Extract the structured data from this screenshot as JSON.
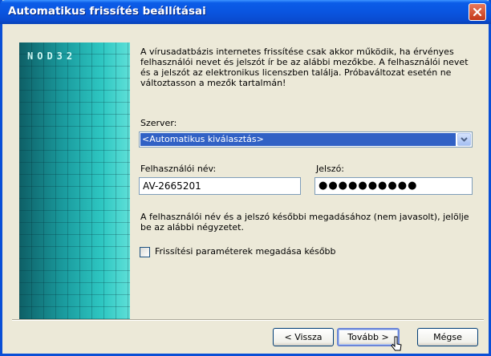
{
  "window": {
    "title": "Automatikus frissítés beállításai"
  },
  "description": "A vírusadatbázis internetes frissítése csak akkor működik, ha érvényes felhasználói nevet és jelszót ír be az alábbi mezőkbe. A felhasználói nevet és a jelszót az elektronikus licenszben találja. Próbaváltozat esetén ne változtasson a mezők tartalmán!",
  "banner": {
    "logo_text": "NOD32"
  },
  "server": {
    "label": "Szerver:",
    "value": "<Automatikus kiválasztás>"
  },
  "username": {
    "label": "Felhasználói név:",
    "value": "AV-2665201"
  },
  "password": {
    "label": "Jelszó:",
    "masked_value": "●●●●●●●●●●"
  },
  "note": "A felhasználói név és a jelszó későbbi megadásához (nem javasolt), jelölje be az alábbi négyzetet.",
  "later_checkbox": {
    "label": "Frissítési paraméterek megadása később",
    "checked": false
  },
  "buttons": {
    "back": "< Vissza",
    "next": "Tovább >",
    "cancel": "Mégse"
  },
  "colors": {
    "titlebar": "#0a55e0",
    "selection": "#3161c5",
    "banner": "#1a9b9e"
  }
}
